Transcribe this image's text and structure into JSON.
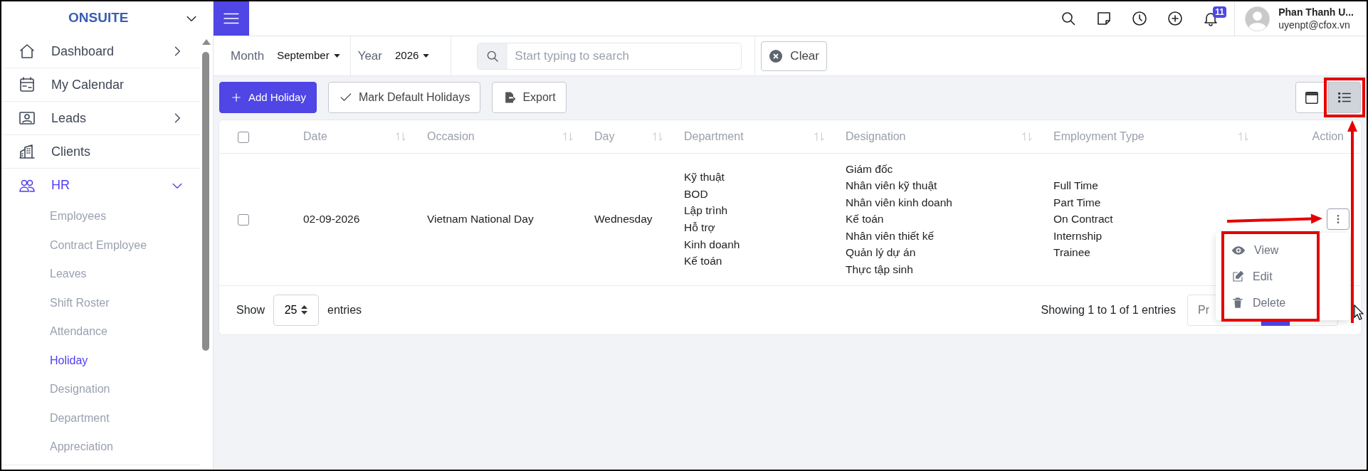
{
  "sidebar": {
    "brand": "ONSUITE",
    "items": [
      {
        "label": "Dashboard",
        "kind": "group",
        "expanded": false,
        "selected": false
      },
      {
        "label": "My Calendar",
        "kind": "link",
        "selected": false
      },
      {
        "label": "Leads",
        "kind": "group",
        "expanded": false,
        "selected": false
      },
      {
        "label": "Clients",
        "kind": "link",
        "selected": false
      },
      {
        "label": "HR",
        "kind": "group",
        "expanded": true,
        "selected": true,
        "children": [
          {
            "label": "Employees",
            "selected": false
          },
          {
            "label": "Contract Employee",
            "selected": false
          },
          {
            "label": "Leaves",
            "selected": false
          },
          {
            "label": "Shift Roster",
            "selected": false
          },
          {
            "label": "Attendance",
            "selected": false
          },
          {
            "label": "Holiday",
            "selected": true
          },
          {
            "label": "Designation",
            "selected": false
          },
          {
            "label": "Department",
            "selected": false
          },
          {
            "label": "Appreciation",
            "selected": false
          }
        ]
      }
    ]
  },
  "topbar": {
    "notification_count": "11",
    "user": {
      "name": "Phan Thanh U...",
      "email": "uyenpt@cfox.vn"
    }
  },
  "filters": {
    "month": {
      "label": "Month",
      "value": "September"
    },
    "year": {
      "label": "Year",
      "value": "2026"
    },
    "search": {
      "placeholder": "Start typing to search"
    },
    "clear": "Clear"
  },
  "toolbar": {
    "buttons": [
      {
        "label": "Add Holiday",
        "kind": "primary"
      },
      {
        "label": "Mark Default Holidays",
        "kind": "check"
      },
      {
        "label": "Export",
        "kind": "export"
      }
    ],
    "views": [
      {
        "kind": "calendar",
        "selected": false
      },
      {
        "kind": "list",
        "selected": true
      }
    ]
  },
  "table": {
    "select_all": {
      "checked": false
    },
    "columns": [
      {
        "label": "Date",
        "sortable": true
      },
      {
        "label": "Occasion",
        "sortable": true
      },
      {
        "label": "Day",
        "sortable": true
      },
      {
        "label": "Department",
        "sortable": true
      },
      {
        "label": "Designation",
        "sortable": true
      },
      {
        "label": "Employment Type",
        "sortable": true
      },
      {
        "label": "Action",
        "sortable": false
      }
    ],
    "rows": [
      {
        "checked": false,
        "date": "02-09-2026",
        "occasion": "Vietnam National Day",
        "day": "Wednesday",
        "departments": [
          "Kỹ thuật",
          "BOD",
          "Lập trình",
          "Hỗ trợ",
          "Kinh doanh",
          "Kế toán"
        ],
        "designations": [
          "Giám đốc",
          "Nhân viên kỹ thuật",
          "Nhân viên kinh doanh",
          "Kế toán",
          "Nhân viên thiết kế",
          "Quản lý dự án",
          "Thực tập sinh"
        ],
        "employment_types": [
          "Full Time",
          "Part Time",
          "On Contract",
          "Internship",
          "Trainee"
        ]
      }
    ]
  },
  "footer": {
    "show": "Show",
    "length": "25",
    "entries": "entries",
    "info": "Showing 1 to 1 of 1 entries",
    "previous": "Pr"
  },
  "action_menu": {
    "items": [
      {
        "label": "View",
        "kind": "view"
      },
      {
        "label": "Edit",
        "kind": "edit"
      },
      {
        "label": "Delete",
        "kind": "delete"
      }
    ]
  }
}
